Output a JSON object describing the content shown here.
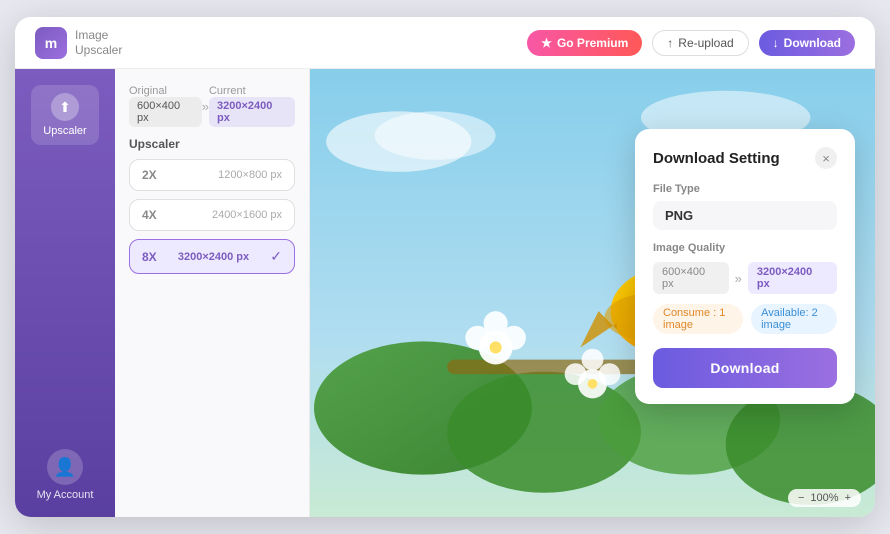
{
  "app": {
    "logo_line1": "Image",
    "logo_line2": "Upscaler",
    "logo_initial": "m"
  },
  "topbar": {
    "premium_label": "Go Premium",
    "reupload_label": "Re-upload",
    "download_label": "Download"
  },
  "sidebar": {
    "nav_item_label": "Upscaler",
    "account_label": "My Account"
  },
  "left_panel": {
    "original_label": "Original",
    "current_label": "Current",
    "original_size": "600×400 px",
    "current_size": "3200×2400 px",
    "upscaler_label": "Upscaler",
    "options": [
      {
        "multiplier": "2X",
        "size": "1200×800 px",
        "active": false
      },
      {
        "multiplier": "4X",
        "size": "2400×1600 px",
        "active": false
      },
      {
        "multiplier": "8X",
        "size": "3200×2400 px",
        "active": true
      }
    ]
  },
  "modal": {
    "title": "Download Setting",
    "file_type_label": "File Type",
    "file_type_value": "PNG",
    "image_quality_label": "Image Quality",
    "quality_from": "600×400 px",
    "quality_to": "3200×2400 px",
    "consume_label": "Consume : 1 image",
    "available_label": "Available: 2 image",
    "download_button": "Download"
  },
  "zoom": {
    "level": "100%"
  },
  "icons": {
    "zoom_out": "−",
    "zoom_in": "+",
    "arrow_right": "»",
    "check": "✓",
    "close": "×",
    "upload": "↑",
    "download_icon": "↓",
    "star": "★"
  }
}
